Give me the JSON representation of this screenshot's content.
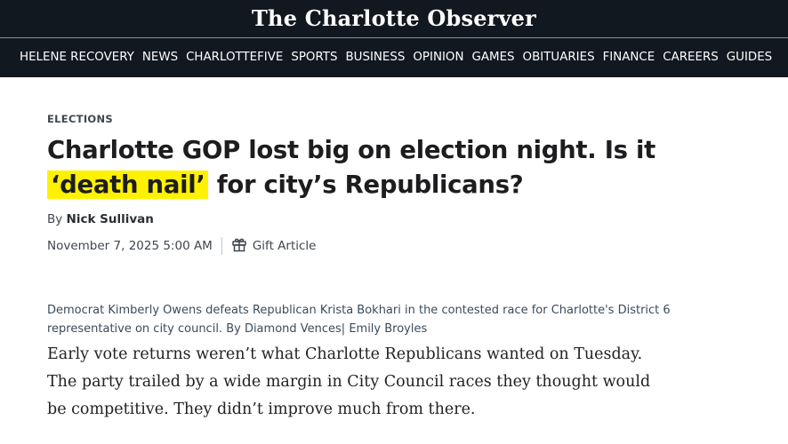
{
  "masthead": {
    "logo": "The Charlotte Observer",
    "nav": [
      "HELENE RECOVERY",
      "NEWS",
      "CHARLOTTEFIVE",
      "SPORTS",
      "BUSINESS",
      "OPINION",
      "GAMES",
      "OBITUARIES",
      "FINANCE",
      "CAREERS",
      "GUIDES"
    ]
  },
  "article": {
    "kicker": "ELECTIONS",
    "headline_pre": "Charlotte GOP lost big on election night. Is it ",
    "headline_highlight": "‘death nail’",
    "headline_post": " for city’s Republicans?",
    "byline_prefix": "By ",
    "author": "Nick Sullivan",
    "date": "November 7, 2025 5:00 AM",
    "gift_label": "Gift Article",
    "caption": "Democrat Kimberly Owens defeats Republican Krista Bokhari in the contested race for Charlotte's District 6 representative on city council. By Diamond Vences| Emily Broyles",
    "body": "Early vote returns weren’t what Charlotte Republicans wanted on Tuesday. The party trailed by a wide margin in City Council races they thought would be competitive. They didn’t improve much from there."
  },
  "colors": {
    "masthead_bg": "#111820",
    "highlight": "#fff200"
  },
  "icons": {
    "gift": "gift-icon"
  }
}
